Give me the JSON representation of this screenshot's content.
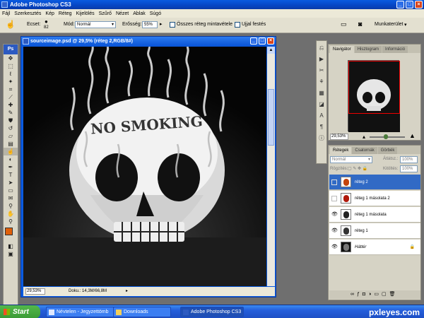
{
  "app": {
    "title": "Adobe Photoshop CS3",
    "logo": "Ps"
  },
  "menu": [
    "Fájl",
    "Szerkesztés",
    "Kép",
    "Réteg",
    "Kijelölés",
    "Szűrő",
    "Nézet",
    "Ablak",
    "Súgó"
  ],
  "options": {
    "brush_label": "Ecset:",
    "brush_size": "82",
    "mode_label": "Mód:",
    "mode_value": "Normál",
    "strength_label": "Erősség:",
    "strength_value": "55%",
    "all_layers_label": "Összes réteg mintavétele",
    "finger_paint_label": "Ujjal festés",
    "workspace_label": "Munkaterület"
  },
  "document": {
    "title": "sourceimage.psd @ 29,5% (réteg 2,RGB/8#)",
    "zoom": "29,53%",
    "doc_info": "Doku.: 14,3M/66,8M",
    "canvas_text": "NO SMOKING"
  },
  "navigator": {
    "tabs": [
      "Navigátor",
      "Hisztogram",
      "Információ"
    ],
    "zoom": "29,53%"
  },
  "layers": {
    "tabs": [
      "Rétegek",
      "Csatornák",
      "Görbék"
    ],
    "blend_mode": "Normál",
    "opacity_label": "Átlátsz.:",
    "opacity_value": "100%",
    "lock_label": "Rögzítés:",
    "fill_label": "Kitöltés:",
    "fill_value": "100%",
    "items": [
      {
        "name": "réteg 2",
        "visible": false,
        "selected": true
      },
      {
        "name": "réteg 1 másolata 2",
        "visible": false,
        "selected": false
      },
      {
        "name": "réteg 1 másolata",
        "visible": true,
        "selected": false
      },
      {
        "name": "réteg 1",
        "visible": true,
        "selected": false
      },
      {
        "name": "Háttér",
        "visible": true,
        "selected": false
      }
    ]
  },
  "taskbar": {
    "start": "Start",
    "tasks": [
      "Névtelen - Jegyzettömb",
      "Downloads",
      "Adobe Photoshop CS3"
    ],
    "watermark": "pxleyes.com"
  },
  "colors": {
    "xp_blue": "#0a5be0",
    "selected_layer": "#316ac5",
    "foreground": "#e0600a",
    "background": "#ffffff"
  }
}
